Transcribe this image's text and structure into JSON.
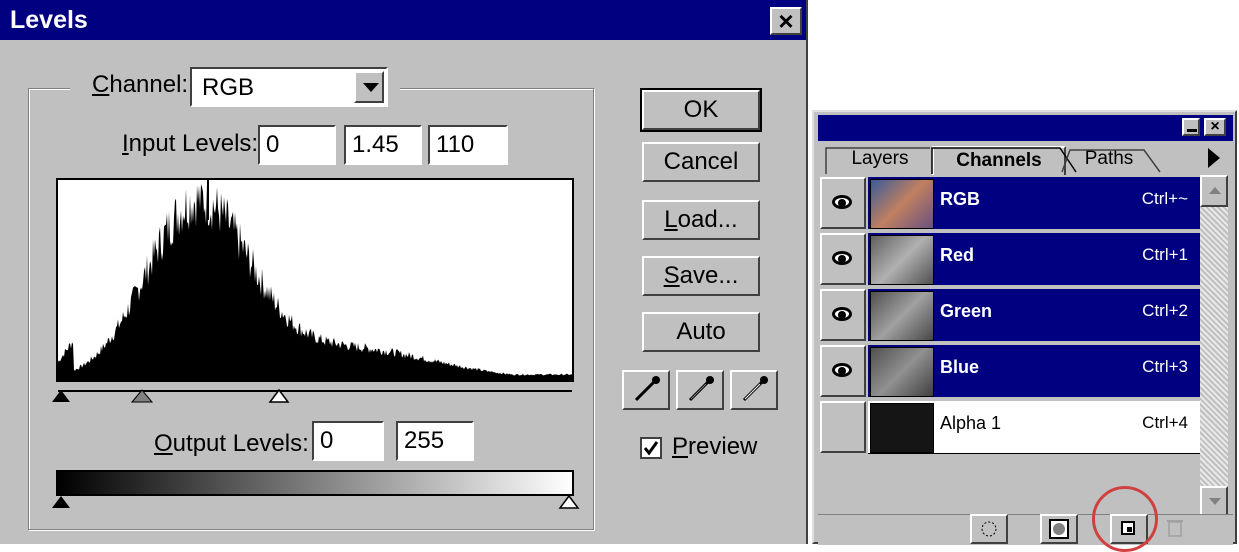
{
  "levels_dialog": {
    "title": "Levels",
    "close_label": "×",
    "channel_label_prefix": "",
    "channel_label_underlined": "C",
    "channel_label_rest": "hannel:",
    "channel_value": "RGB",
    "input_levels_label_underlined": "I",
    "input_levels_label_rest": "nput Levels:",
    "input_levels": {
      "black": "0",
      "gamma": "1.45",
      "white": "110"
    },
    "output_levels_label_underlined": "O",
    "output_levels_label_rest": "utput Levels:",
    "output_levels": {
      "black": "0",
      "white": "255"
    },
    "buttons": {
      "ok": "OK",
      "cancel": "Cancel",
      "load_underlined": "L",
      "load_rest": "oad...",
      "save_underlined": "S",
      "save_rest": "ave...",
      "auto": "Auto"
    },
    "preview_underlined": "P",
    "preview_rest": "review",
    "preview_checked": true
  },
  "channels_palette": {
    "tabs": [
      {
        "label": "Layers",
        "active": false
      },
      {
        "label": "Channels",
        "active": true
      },
      {
        "label": "Paths",
        "active": false
      }
    ],
    "channels": [
      {
        "name": "RGB",
        "shortcut": "Ctrl+~",
        "visible": true,
        "selected": true,
        "thumb": "color"
      },
      {
        "name": "Red",
        "shortcut": "Ctrl+1",
        "visible": true,
        "selected": true,
        "thumb": "gray"
      },
      {
        "name": "Green",
        "shortcut": "Ctrl+2",
        "visible": true,
        "selected": true,
        "thumb": "gray"
      },
      {
        "name": "Blue",
        "shortcut": "Ctrl+3",
        "visible": true,
        "selected": true,
        "thumb": "gray"
      },
      {
        "name": "Alpha 1",
        "shortcut": "Ctrl+4",
        "visible": false,
        "selected": false,
        "thumb": "dark"
      }
    ],
    "bottom_buttons": [
      "load-selection-icon",
      "save-selection-icon",
      "new-channel-icon",
      "trash-icon"
    ]
  },
  "colors": {
    "title_bar": "#000080",
    "selection": "#000080",
    "face": "#c0c0c0",
    "highlight_circle": "#d04040"
  }
}
